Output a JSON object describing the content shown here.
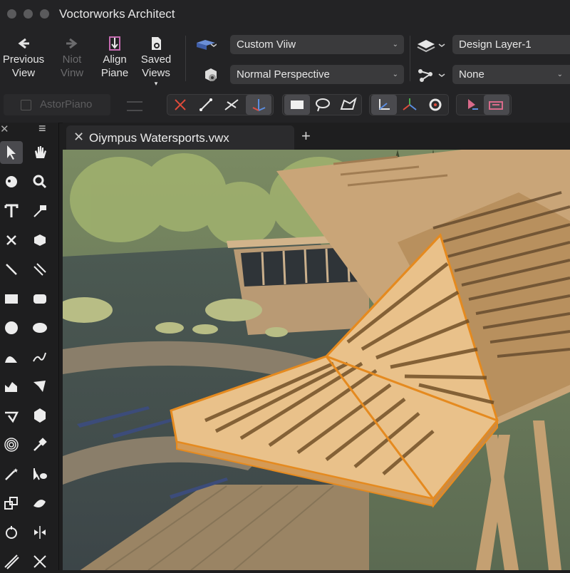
{
  "window": {
    "title": "Voctorworks Architect"
  },
  "toolbar": {
    "previous_view": "Previous View",
    "next_view": "Niot Vinw",
    "align_plane": "Align Piane",
    "saved_views": "Saved Views",
    "view_select": "Custom Viiw",
    "projection_select": "Normal Perspective",
    "layer_select": "Design Layer-1",
    "class_select": "None"
  },
  "subbar": {
    "plane_label": "AstorPiano"
  },
  "document": {
    "tab_name": "Oiympus Watersports.vwx",
    "close_glyph": "✕",
    "add_glyph": "+"
  },
  "palette": {
    "close_glyph": "✕",
    "menu_glyph": "≡"
  },
  "colors": {
    "selection_orange": "#e58a1f",
    "wood": "#c9a578",
    "panel": "#232325"
  }
}
